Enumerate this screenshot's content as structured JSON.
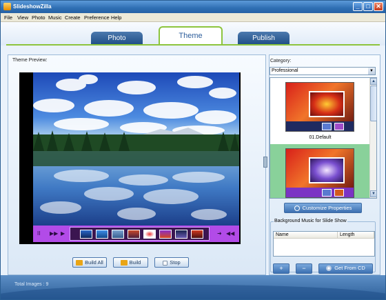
{
  "app": {
    "title": "SlideshowZilla"
  },
  "window_controls": {
    "minimize": "_",
    "maximize": "□",
    "close": "✕"
  },
  "menu": [
    "File",
    "View",
    "Photo",
    "Music",
    "Create",
    "Preference",
    "Help"
  ],
  "tabs": [
    {
      "label": "Photo",
      "active": false
    },
    {
      "label": "Theme",
      "active": true
    },
    {
      "label": "Publish",
      "active": false
    }
  ],
  "preview": {
    "label": "Theme Preview:",
    "playback_controls": {
      "pause": "II",
      "next": "▶▶",
      "play": "▶",
      "forward": "➜",
      "rewind": "◀◀"
    },
    "thumbnail_count": 8
  },
  "actions": {
    "build_all": "Build All",
    "build": "Build",
    "stop": "Stop"
  },
  "category": {
    "label": "Category:",
    "selected": "Professional",
    "themes": [
      {
        "name": "01.Default",
        "selected": false
      },
      {
        "name": "",
        "selected": true
      }
    ]
  },
  "customize_label": "Customize Properties",
  "music": {
    "group_title": "Background Music for Slide Show",
    "columns": [
      "Name",
      "Length"
    ],
    "add": "+",
    "remove": "−",
    "get_from_cd": "Get From CD"
  },
  "status": {
    "text": "Total Images : 9"
  },
  "colors": {
    "accent_green": "#8cc43c",
    "title_blue": "#2f6fb3",
    "control_purple": "#b24be8",
    "theme_selection": "#89d19a"
  }
}
